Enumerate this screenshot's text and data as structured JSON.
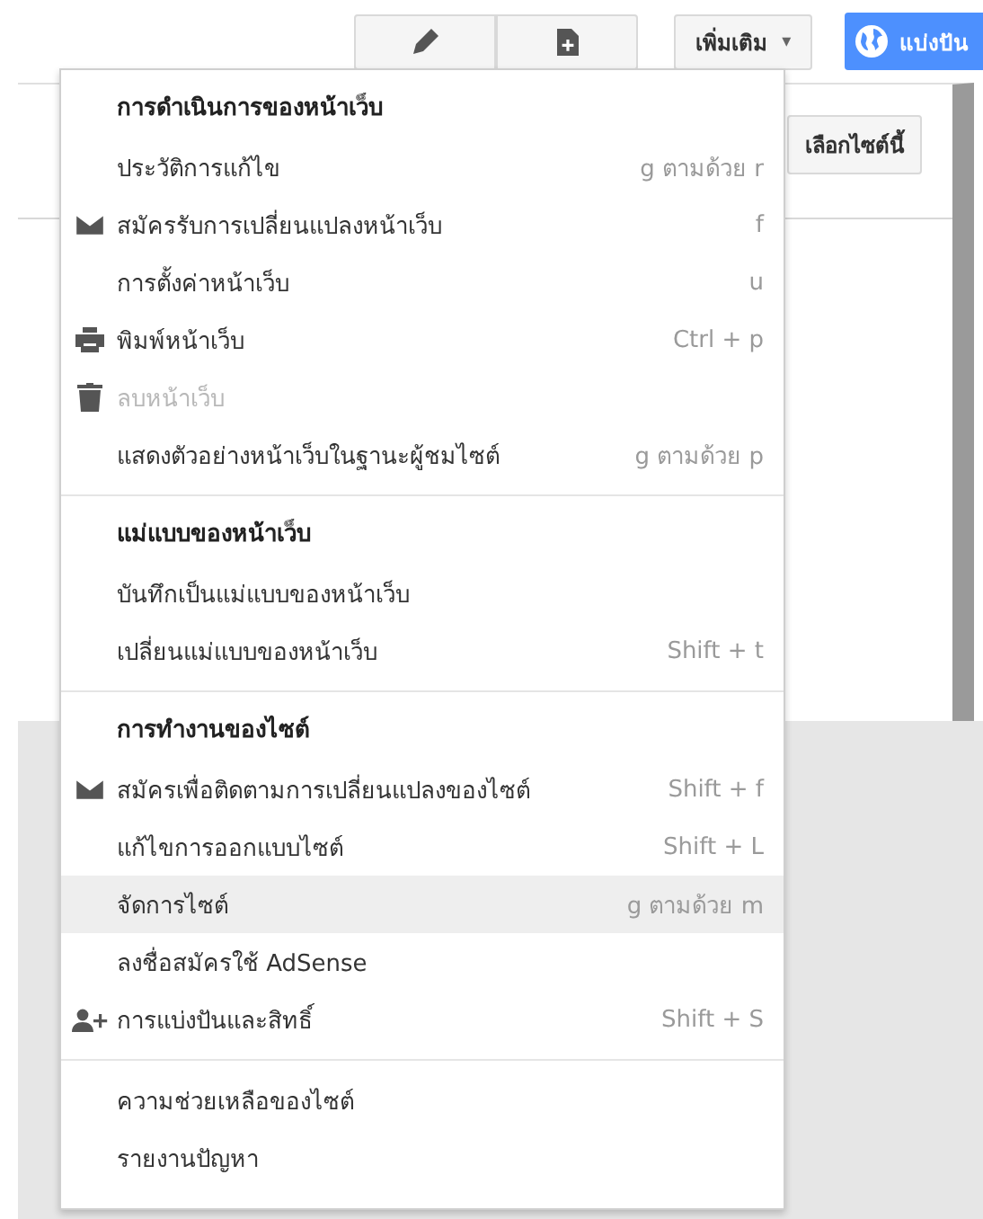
{
  "toolbar": {
    "more_button": {
      "label": "เพิ่มเติม",
      "caret": "▾"
    },
    "share_button": {
      "label": "แบ่งปัน"
    }
  },
  "page": {
    "choose_site_button": "เลือกไซต์นี้"
  },
  "menu": {
    "sections": [
      {
        "title": "การดำเนินการของหน้าเว็บ",
        "items": [
          {
            "label": "ประวัติการแก้ไข",
            "shortcut": "g ตามด้วย r",
            "kind": "plain",
            "disabled": false,
            "selected": false
          },
          {
            "label": "สมัครรับการเปลี่ยนแปลงหน้าเว็บ",
            "shortcut": "f",
            "kind": "mail",
            "disabled": false,
            "selected": false
          },
          {
            "label": "การตั้งค่าหน้าเว็บ",
            "shortcut": "u",
            "kind": "plain",
            "disabled": false,
            "selected": false
          },
          {
            "label": "พิมพ์หน้าเว็บ",
            "shortcut": "Ctrl + p",
            "kind": "print",
            "disabled": false,
            "selected": false
          },
          {
            "label": "ลบหน้าเว็บ",
            "kind": "trash",
            "disabled": true,
            "selected": false
          },
          {
            "label": "แสดงตัวอย่างหน้าเว็บในฐานะผู้ชมไซต์",
            "shortcut": "g ตามด้วย p",
            "kind": "plain",
            "disabled": false,
            "selected": false
          }
        ]
      },
      {
        "title": "แม่แบบของหน้าเว็บ",
        "items": [
          {
            "label": "บันทึกเป็นแม่แบบของหน้าเว็บ",
            "kind": "plain",
            "disabled": false,
            "selected": false
          },
          {
            "label": "เปลี่ยนแม่แบบของหน้าเว็บ",
            "shortcut": "Shift + t",
            "kind": "plain",
            "disabled": false,
            "selected": false
          }
        ]
      },
      {
        "title": "การทำงานของไซต์",
        "items": [
          {
            "label": "สมัครเพื่อติดตามการเปลี่ยนแปลงของไซต์",
            "shortcut": "Shift + f",
            "kind": "mail",
            "disabled": false,
            "selected": false
          },
          {
            "label": "แก้ไขการออกแบบไซต์",
            "shortcut": "Shift + L",
            "kind": "plain",
            "disabled": false,
            "selected": false
          },
          {
            "label": "จัดการไซต์",
            "shortcut": "g ตามด้วย m",
            "kind": "plain",
            "disabled": false,
            "selected": true
          },
          {
            "label": "ลงชื่อสมัครใช้ AdSense",
            "kind": "plain",
            "disabled": false,
            "selected": false
          },
          {
            "label": "การแบ่งปันและสิทธิ์",
            "shortcut": "Shift + S",
            "kind": "person-add",
            "disabled": false,
            "selected": false
          }
        ]
      },
      {
        "items": [
          {
            "label": "ความช่วยเหลือของไซต์",
            "kind": "plain",
            "disabled": false,
            "selected": false
          },
          {
            "label": "รายงานปัญหา",
            "kind": "plain",
            "disabled": false,
            "selected": false
          }
        ]
      }
    ]
  }
}
